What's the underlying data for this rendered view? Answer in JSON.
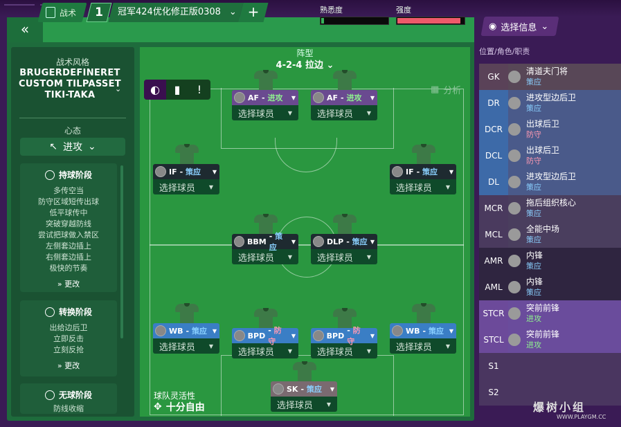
{
  "header": {
    "tab_label": "战术",
    "slot_number": "1",
    "tactic_name": "冠军424优化修正版0308",
    "familiarity_label": "熟悉度",
    "familiarity_value": 0.04,
    "intensity_label": "强度",
    "intensity_value": 0.95
  },
  "left": {
    "style_label": "战术风格",
    "style_name": "BRUGERDEFINERET CUSTOM TILPASSET TIKI-TAKA",
    "mentality_label": "心态",
    "mentality_value": "进攻",
    "phases": [
      {
        "title": "持球阶段",
        "items": [
          "多传空当",
          "防守区域短传出球",
          "低平球传中",
          "突破穿越防线",
          "尝试把球做入禁区",
          "左侧套边插上",
          "右侧套边插上",
          "极快的节奏"
        ],
        "change": "更改"
      },
      {
        "title": "转换阶段",
        "items": [
          "出给边后卫",
          "立即反击",
          "立刻反抢"
        ],
        "change": "更改"
      },
      {
        "title": "无球阶段",
        "items": [
          "防线收缩"
        ]
      }
    ]
  },
  "pitch": {
    "formation_label": "阵型",
    "formation_value": "4-2-4 拉边",
    "analysis_label": "分析",
    "fluidity_label": "球队灵活性",
    "fluidity_value": "十分自由",
    "select_player": "选择球员",
    "cards": [
      {
        "pos": "AF",
        "duty": "进攻"
      },
      {
        "pos": "AF",
        "duty": "进攻"
      },
      {
        "pos": "IF",
        "duty": "策应"
      },
      {
        "pos": "IF",
        "duty": "策应"
      },
      {
        "pos": "BBM",
        "duty": "策应"
      },
      {
        "pos": "DLP",
        "duty": "策应"
      },
      {
        "pos": "WB",
        "duty": "策应"
      },
      {
        "pos": "BPD",
        "duty": "防守"
      },
      {
        "pos": "BPD",
        "duty": "防守"
      },
      {
        "pos": "WB",
        "duty": "策应"
      },
      {
        "pos": "SK",
        "duty": "策应"
      }
    ]
  },
  "right": {
    "info_select": "选择信息",
    "caption": "位置/角色/职责",
    "rows": [
      {
        "pos": "GK",
        "role": "清道夫门将",
        "duty": "策应"
      },
      {
        "pos": "DR",
        "role": "进攻型边后卫",
        "duty": "策应"
      },
      {
        "pos": "DCR",
        "role": "出球后卫",
        "duty": "防守"
      },
      {
        "pos": "DCL",
        "role": "出球后卫",
        "duty": "防守"
      },
      {
        "pos": "DL",
        "role": "进攻型边后卫",
        "duty": "策应"
      },
      {
        "pos": "MCR",
        "role": "拖后组织核心",
        "duty": "策应"
      },
      {
        "pos": "MCL",
        "role": "全能中场",
        "duty": "策应"
      },
      {
        "pos": "AMR",
        "role": "内锋",
        "duty": "策应"
      },
      {
        "pos": "AML",
        "role": "内锋",
        "duty": "策应"
      },
      {
        "pos": "STCR",
        "role": "突前前锋",
        "duty": "进攻"
      },
      {
        "pos": "STCL",
        "role": "突前前锋",
        "duty": "进攻"
      },
      {
        "pos": "S1",
        "role": "",
        "duty": ""
      },
      {
        "pos": "S2",
        "role": "",
        "duty": ""
      }
    ]
  },
  "watermark": {
    "text": "爆树小组",
    "url": "WWW.PLAYGM.CC"
  }
}
